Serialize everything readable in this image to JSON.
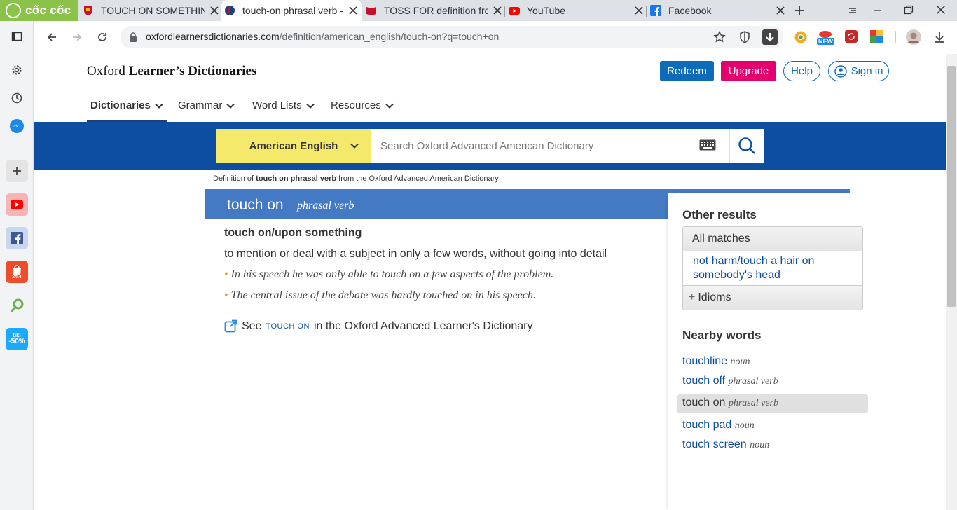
{
  "browser": {
    "brand": "cốc cốc",
    "tabs": [
      {
        "title": "TOUCH ON SOMETHING",
        "active": false
      },
      {
        "title": "touch-on phrasal verb -",
        "active": true
      },
      {
        "title": "TOSS FOR definition fro",
        "active": false
      },
      {
        "title": "YouTube",
        "active": false
      },
      {
        "title": "Facebook",
        "active": false
      }
    ],
    "url_host": "oxfordlearnersdictionaries.com",
    "url_path": "/definition/american_english/touch-on?q=touch+on",
    "sidebar_badges": {
      "shopee": "24.4",
      "tiki_top": "tiki",
      "tiki_bottom": "-50%"
    },
    "toolbar_badge": "NEW"
  },
  "header": {
    "logo_regular": "Oxford ",
    "logo_bold": "Learner’s Dictionaries",
    "redeem": "Redeem",
    "upgrade": "Upgrade",
    "help": "Help",
    "signin": "Sign in"
  },
  "nav": {
    "dictionaries": "Dictionaries",
    "grammar": "Grammar",
    "word_lists": "Word Lists",
    "resources": "Resources"
  },
  "search": {
    "dictionary": "American English",
    "placeholder": "Search Oxford Advanced American Dictionary"
  },
  "entry": {
    "source_prefix": "Definition of ",
    "source_word": "touch on phrasal verb",
    "source_suffix": " from the Oxford Advanced American Dictionary",
    "headword": "touch on",
    "pos": "phrasal verb",
    "sense_title": "touch on/upon something",
    "definition": "to mention or deal with a subject in only a few words, without going into detail",
    "examples": [
      "In his speech he was only able to touch on a few aspects of the problem.",
      "The central issue of the debate was hardly touched on in his speech."
    ],
    "see_prefix": "See ",
    "see_word": "touch on",
    "see_suffix": " in the Oxford Advanced Learner's Dictionary"
  },
  "sidebar_results": {
    "other_results": "Other results",
    "all_matches": "All matches",
    "match_link": "not harm/touch a hair on somebody's head",
    "idioms": "Idioms",
    "nearby_words": "Nearby words",
    "nearby": [
      {
        "word": "touchline",
        "pos": "noun"
      },
      {
        "word": "touch off",
        "pos": "phrasal verb"
      },
      {
        "word": "touch on",
        "pos": "phrasal verb"
      },
      {
        "word": "touch pad",
        "pos": "noun"
      },
      {
        "word": "touch screen",
        "pos": "noun"
      }
    ]
  },
  "colors": {
    "brand_green": "#8bc34a",
    "search_band": "#0d4ea1",
    "headword_bar": "#4479c4",
    "select_yellow": "#f5e96c",
    "redeem_blue": "#0d6bb8",
    "upgrade_pink": "#e4006e"
  }
}
